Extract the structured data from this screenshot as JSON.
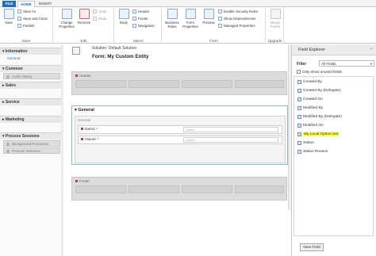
{
  "tabs": [
    {
      "label": "FILE"
    },
    {
      "label": "HOME"
    },
    {
      "label": "INSERT"
    }
  ],
  "ribbon": {
    "save": "Save",
    "save_as": "Save As",
    "save_and_close": "Save and Close",
    "publish": "Publish",
    "save_group": "Save",
    "change_properties": "Change Properties",
    "remove": "Remove",
    "undo": "Undo",
    "redo": "Redo",
    "edit_group": "Edit",
    "body": "Body",
    "header": "Header",
    "footer": "Footer",
    "navigation": "Navigation",
    "select_group": "Select",
    "business_rules": "Business Rules",
    "form_properties": "Form Properties",
    "preview": "Preview",
    "enable_security_roles": "Enable Security Roles",
    "show_dependencies": "Show Dependencies",
    "managed_properties": "Managed Properties",
    "form_group": "Form",
    "merge_forms": "Merge Forms",
    "upgrade_group": "Upgrade"
  },
  "leftnav": {
    "information": "Information",
    "general": "General",
    "common": "Common",
    "audit_history": "Audit History",
    "sales": "Sales",
    "service": "Service",
    "marketing": "Marketing",
    "process_sessions": "Process Sessions",
    "background_processes": "Background Processes",
    "process_sessions_item": "Process Sessions"
  },
  "form": {
    "solution": "Solution: Default Solution",
    "title": "Form: My Custom Entity",
    "header_label": "Header",
    "general_title": "General",
    "general_sub": "General",
    "name_label": "Name",
    "name_placeholder": "Name",
    "owner_label": "Owner",
    "owner_placeholder": "Owner",
    "footer_label": "Footer"
  },
  "explorer": {
    "title": "Field Explorer",
    "filter_label": "Filter",
    "filter_value": "All Fields",
    "unused_only": "Only show unused fields",
    "fields": [
      "Created By",
      "Created By (Delegate)",
      "Created On",
      "Modified By",
      "Modified By (Delegate)",
      "Modified On",
      "My Local Option Set",
      "Status",
      "Status Reason"
    ],
    "highlight_color": "#ffff33",
    "new_field": "New Field"
  },
  "colors": {
    "accent": "#1f6ec2",
    "section_border": "#7fbccd"
  }
}
